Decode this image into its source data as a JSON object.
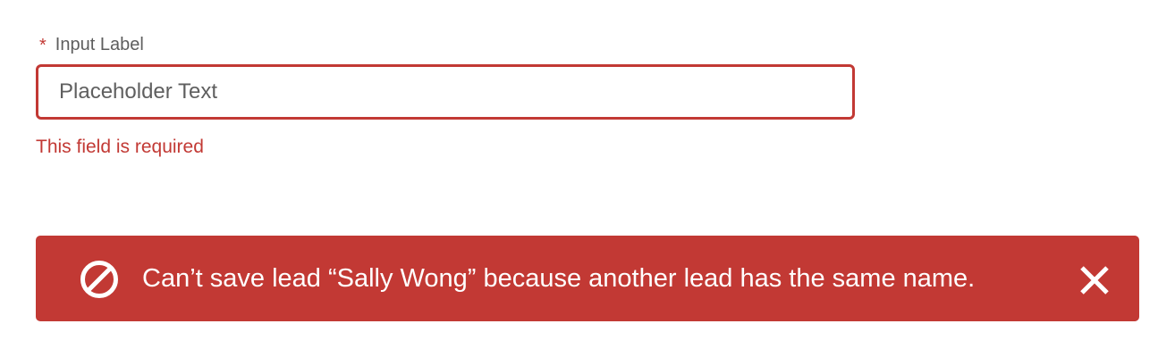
{
  "form": {
    "required_mark": "*",
    "label": "Input Label",
    "input_placeholder": "Placeholder Text",
    "input_value": "",
    "error_message": "This field is required"
  },
  "toast": {
    "variant": "error",
    "background_color": "#c23934",
    "icon": "ban-icon",
    "message": "Can’t save lead “Sally Wong” because another lead has the same name.",
    "close_icon": "close-icon"
  },
  "colors": {
    "error": "#c23934",
    "label": "#5e5e5e",
    "placeholder": "#5f5f5f",
    "toast_text": "#ffffff"
  }
}
